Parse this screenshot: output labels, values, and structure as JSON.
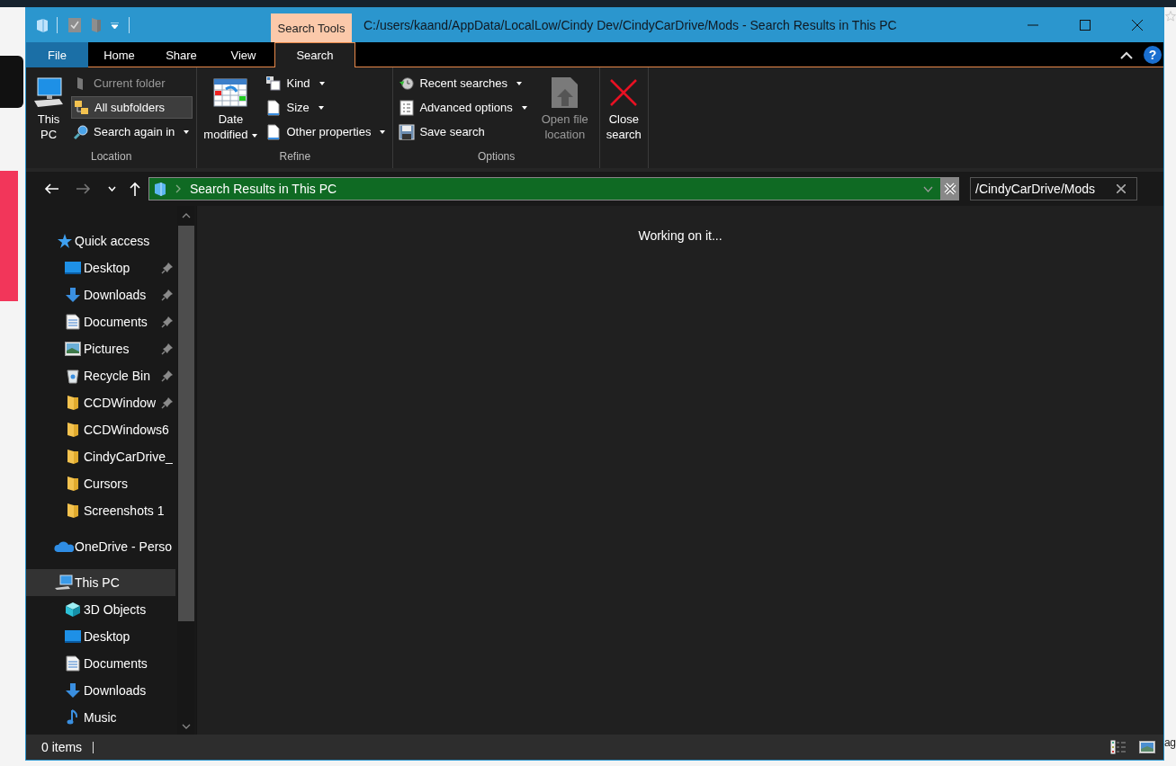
{
  "background": {
    "fragment": "ag"
  },
  "window": {
    "title": "C:/users/kaand/AppData/LocalLow/Cindy Dev/CindyCarDrive/Mods - Search Results in This PC",
    "context_tab": "Search Tools"
  },
  "ribbon": {
    "tabs": [
      {
        "label": "File",
        "kind": "file",
        "selected": false
      },
      {
        "label": "Home",
        "kind": "tab",
        "selected": false
      },
      {
        "label": "Share",
        "kind": "tab",
        "selected": false
      },
      {
        "label": "View",
        "kind": "tab",
        "selected": false
      },
      {
        "label": "Search",
        "kind": "tab",
        "selected": true
      }
    ],
    "help": "?",
    "groups": [
      {
        "label": "Location",
        "items": [
          {
            "kind": "large",
            "label": "This PC",
            "dropdown": false,
            "disabled": false
          },
          {
            "kind": "stack",
            "items": [
              {
                "label": "Current folder",
                "dropdown": false,
                "disabled": true,
                "selected": false
              },
              {
                "label": "All subfolders",
                "dropdown": false,
                "disabled": false,
                "selected": true
              },
              {
                "label": "Search again in",
                "dropdown": true,
                "disabled": false,
                "selected": false
              }
            ]
          }
        ]
      },
      {
        "label": "Refine",
        "items": [
          {
            "kind": "large",
            "label": "Date modified",
            "dropdown": true,
            "disabled": false
          },
          {
            "kind": "stack",
            "items": [
              {
                "label": "Kind",
                "dropdown": true,
                "disabled": false,
                "selected": false
              },
              {
                "label": "Size",
                "dropdown": true,
                "disabled": false,
                "selected": false
              },
              {
                "label": "Other properties",
                "dropdown": true,
                "disabled": false,
                "selected": false
              }
            ]
          }
        ]
      },
      {
        "label": "Options",
        "items": [
          {
            "kind": "stack",
            "items": [
              {
                "label": "Recent searches",
                "dropdown": true,
                "disabled": false,
                "selected": false
              },
              {
                "label": "Advanced options",
                "dropdown": true,
                "disabled": false,
                "selected": false
              },
              {
                "label": "Save search",
                "dropdown": false,
                "disabled": false,
                "selected": false
              }
            ]
          },
          {
            "kind": "large",
            "label": "Open file location",
            "dropdown": false,
            "disabled": true
          }
        ]
      },
      {
        "items": [
          {
            "kind": "large",
            "label": "Close search",
            "dropdown": false,
            "disabled": false
          }
        ]
      }
    ]
  },
  "address_bar": {
    "location": "Search Results in This PC",
    "search_value": "/CindyCarDrive/Mods"
  },
  "nav": {
    "items": [
      {
        "label": "Quick access",
        "selected": false,
        "children": [
          {
            "label": "Desktop",
            "pinned": true,
            "selected": false
          },
          {
            "label": "Downloads",
            "pinned": true,
            "selected": false
          },
          {
            "label": "Documents",
            "pinned": true,
            "selected": false
          },
          {
            "label": "Pictures",
            "pinned": true,
            "selected": false
          },
          {
            "label": "Recycle Bin",
            "pinned": true,
            "selected": false
          },
          {
            "label": "CCDWindow",
            "pinned": true,
            "selected": false
          },
          {
            "label": "CCDWindows6",
            "pinned": false,
            "selected": false
          },
          {
            "label": "CindyCarDrive_",
            "pinned": false,
            "selected": false
          },
          {
            "label": "Cursors",
            "pinned": false,
            "selected": false
          },
          {
            "label": "Screenshots 1",
            "pinned": false,
            "selected": false
          }
        ]
      },
      {
        "label": "OneDrive - Perso",
        "selected": false
      },
      {
        "label": "This PC",
        "selected": true,
        "children": [
          {
            "label": "3D Objects",
            "selected": false
          },
          {
            "label": "Desktop",
            "selected": false
          },
          {
            "label": "Documents",
            "selected": false
          },
          {
            "label": "Downloads",
            "selected": false
          },
          {
            "label": "Music",
            "selected": false
          }
        ]
      }
    ]
  },
  "content": {
    "message": "Working on it..."
  },
  "status_bar": {
    "item_count": "0 items"
  }
}
